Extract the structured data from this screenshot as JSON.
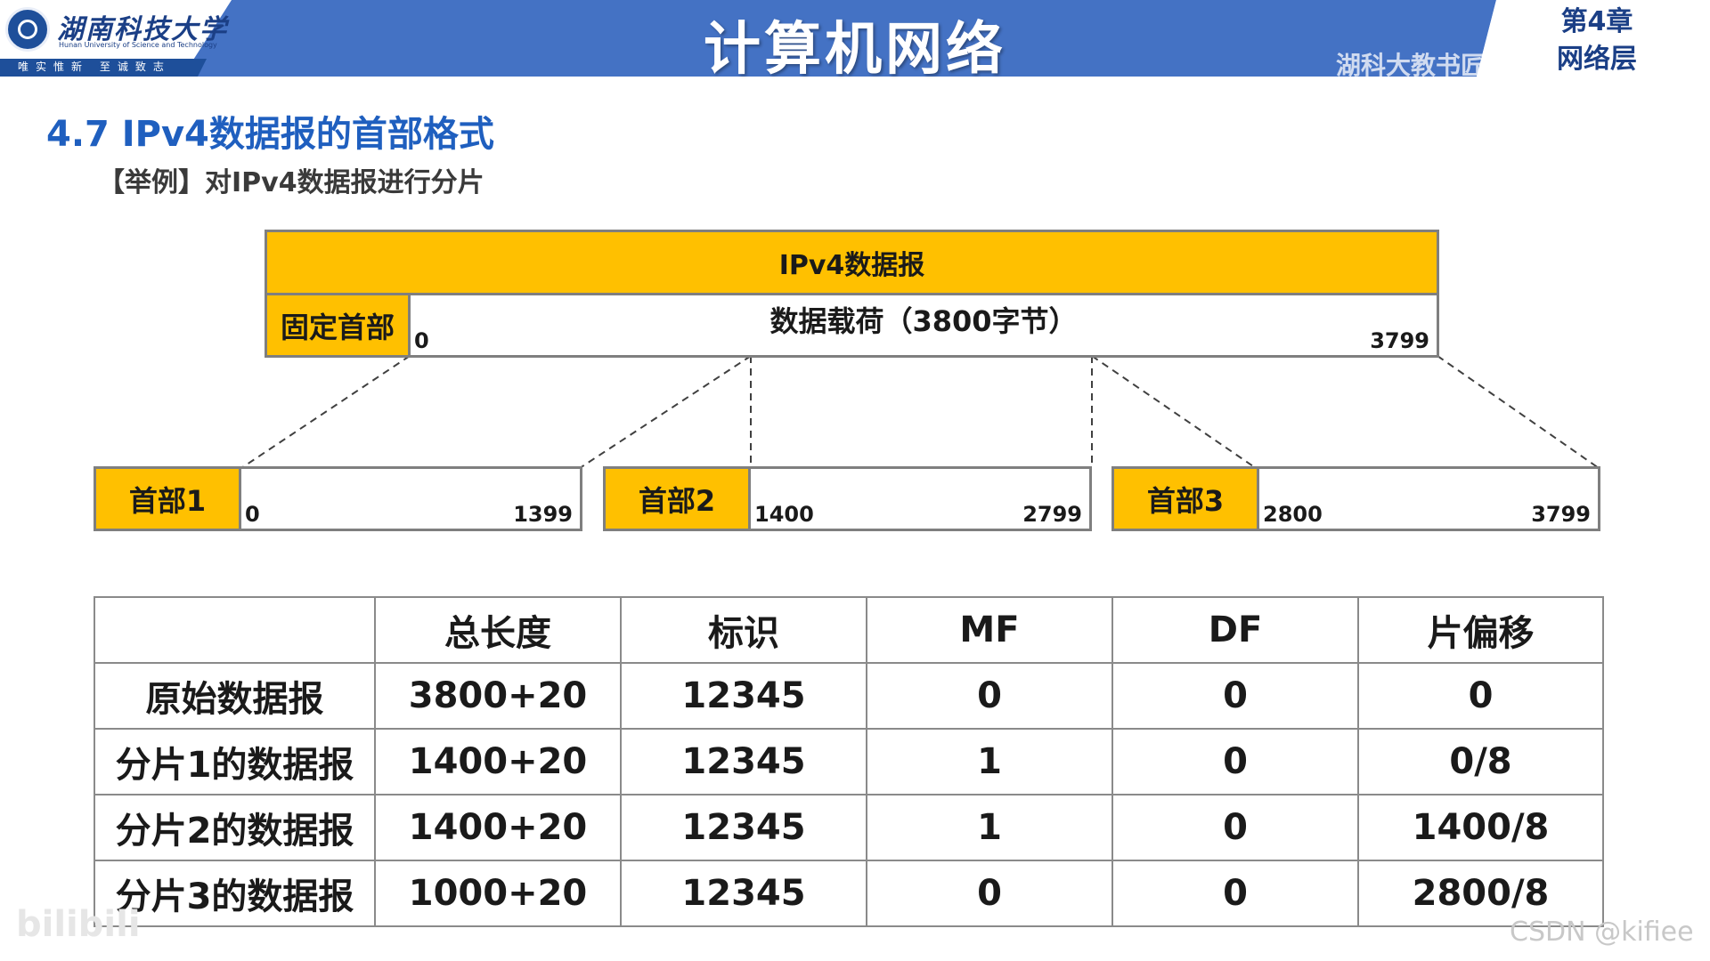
{
  "header": {
    "university_name": "湖南科技大学",
    "university_en": "Hunan University of Science and Technology",
    "motto": "唯实惟新 至诚致志",
    "title": "计算机网络",
    "watermark": "湖科大教书匠",
    "chapter_line1": "第4章",
    "chapter_line2": "网络层",
    "banner_color": "#4472c4"
  },
  "section": {
    "title": "4.7 IPv4数据报的首部格式",
    "subtitle": "【举例】对IPv4数据报进行分片"
  },
  "datagram": {
    "label": "IPv4数据报",
    "header_label": "固定首部",
    "payload_label": "数据载荷（3800字节）",
    "start": "0",
    "end": "3799"
  },
  "fragments": [
    {
      "header": "首部1",
      "start": "0",
      "end": "1399"
    },
    {
      "header": "首部2",
      "start": "1400",
      "end": "2799"
    },
    {
      "header": "首部3",
      "start": "2800",
      "end": "3799"
    }
  ],
  "table": {
    "columns": [
      "",
      "总长度",
      "标识",
      "MF",
      "DF",
      "片偏移"
    ],
    "rows": [
      [
        "原始数据报",
        "3800+20",
        "12345",
        "0",
        "0",
        "0"
      ],
      [
        "分片1的数据报",
        "1400+20",
        "12345",
        "1",
        "0",
        "0/8"
      ],
      [
        "分片2的数据报",
        "1400+20",
        "12345",
        "1",
        "0",
        "1400/8"
      ],
      [
        "分片3的数据报",
        "1000+20",
        "12345",
        "0",
        "0",
        "2800/8"
      ]
    ]
  },
  "footer": {
    "csdn": "CSDN @kifiee",
    "bilibili": "bilibili"
  },
  "colors": {
    "gold": "#ffc000",
    "section_blue": "#1f5fbf"
  }
}
